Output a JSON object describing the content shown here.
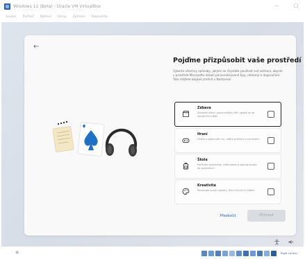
{
  "window": {
    "title": "Windows 11 (Beta) - Oracle VM VirtualBox",
    "minimize_glyph": "—",
    "maximize_glyph": "□"
  },
  "menu": {
    "items": [
      "Soubor",
      "Počítač",
      "Náhled",
      "Vstup",
      "Zařízení",
      "Nápověda"
    ]
  },
  "oobe": {
    "back_glyph": "←",
    "heading": "Pojďme přizpůsobit vaše prostředí",
    "description": "Vyberte všechny způsoby, jakými se chystáte používat své zařízení, abyste v prostředí Microsoftu získali personalizované tipy, reklamy a doporučení. Toto můžete kdykoli změnit v Nastavení.",
    "options": [
      {
        "title": "Zábava",
        "desc": "Sledujte videa, poslouchejte sítě, spojte se se sociálními médii",
        "icon": "clapperboard-icon",
        "selected": true
      },
      {
        "title": "Hraní",
        "desc": "Hrajte a objevujte hry, mějte přehled o novinkách",
        "icon": "gamepad-icon",
        "selected": false
      },
      {
        "title": "Škola",
        "desc": "Počítejte poznámky, pište eseje a spolupracujte na projektech",
        "icon": "backpack-icon",
        "selected": false
      },
      {
        "title": "Kreativita",
        "desc": "Realizujte svoje nápady, díky kterým a videím",
        "icon": "palette-icon",
        "selected": false
      }
    ],
    "skip_label": "Přeskočit",
    "accept_label": "Přijmout"
  },
  "statusbar": {
    "host_key": "Right Control"
  },
  "colors": {
    "accent": "#1a5fb4",
    "spade_blue": "#1f6fc2",
    "card_bg": "#f9f9f9"
  }
}
